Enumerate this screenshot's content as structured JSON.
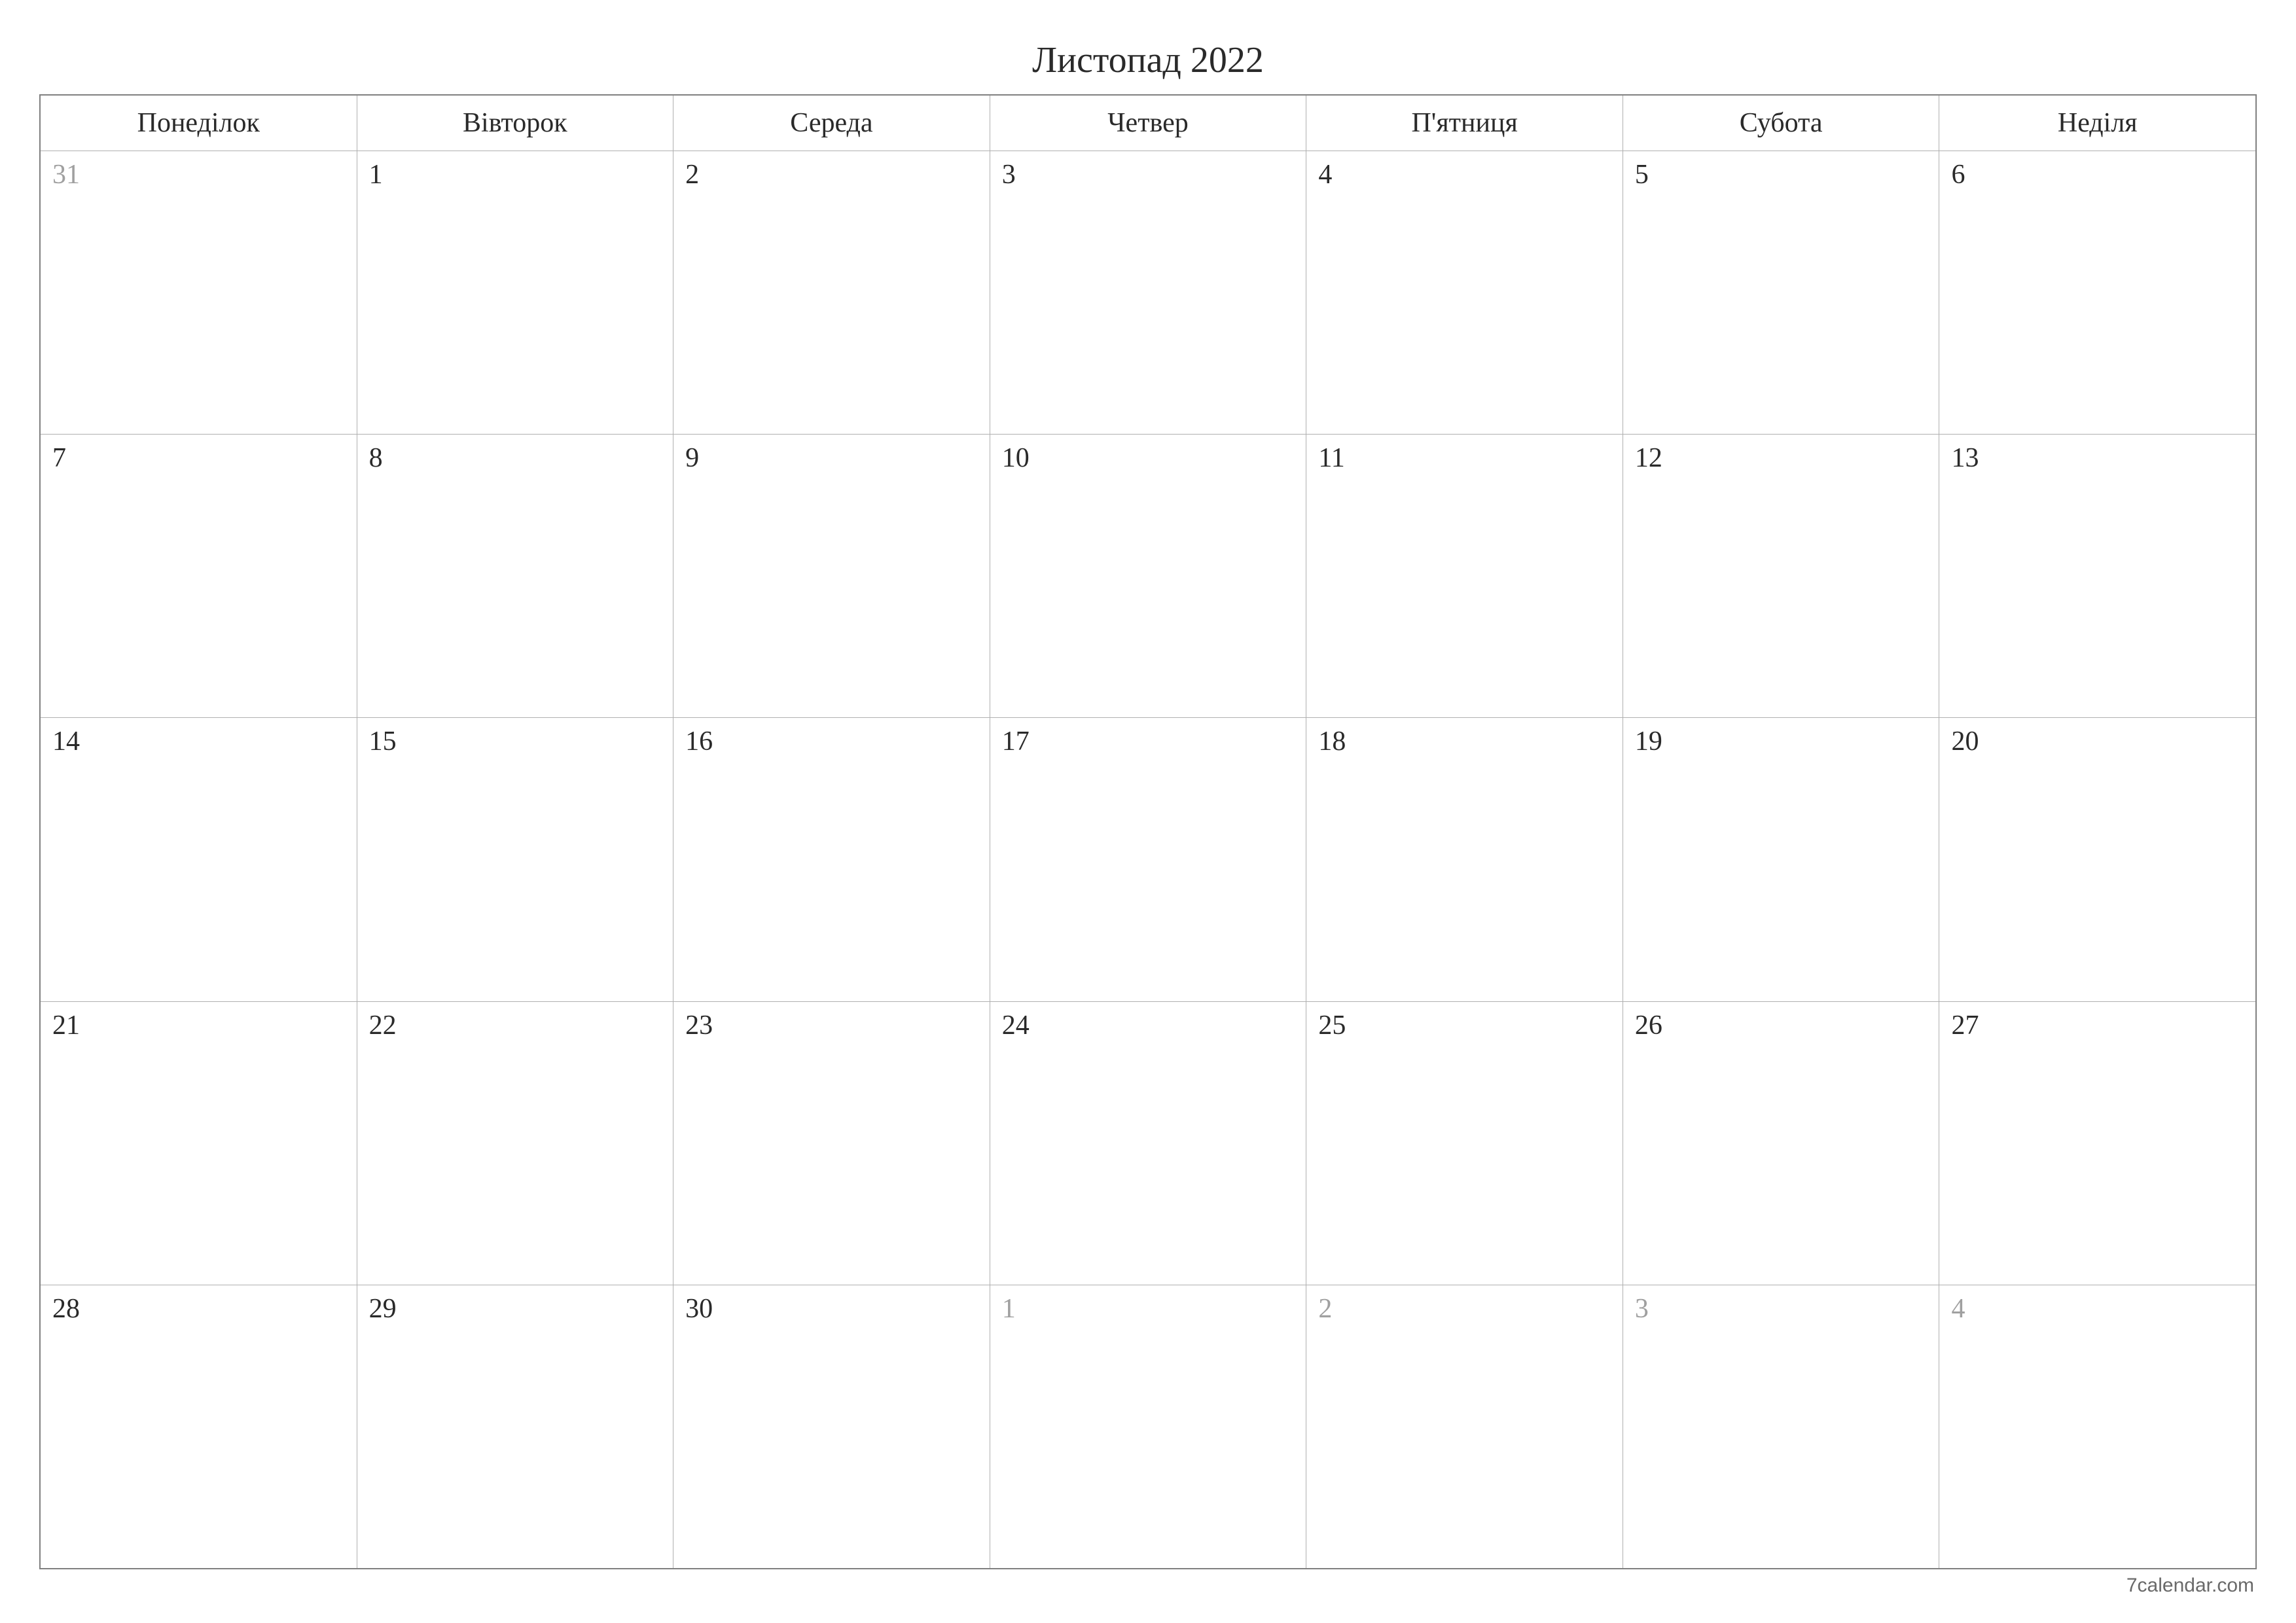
{
  "title": "Листопад 2022",
  "weekdays": [
    "Понеділок",
    "Вівторок",
    "Середа",
    "Четвер",
    "П'ятниця",
    "Субота",
    "Неділя"
  ],
  "weeks": [
    [
      {
        "day": "31",
        "other": true
      },
      {
        "day": "1",
        "other": false
      },
      {
        "day": "2",
        "other": false
      },
      {
        "day": "3",
        "other": false
      },
      {
        "day": "4",
        "other": false
      },
      {
        "day": "5",
        "other": false
      },
      {
        "day": "6",
        "other": false
      }
    ],
    [
      {
        "day": "7",
        "other": false
      },
      {
        "day": "8",
        "other": false
      },
      {
        "day": "9",
        "other": false
      },
      {
        "day": "10",
        "other": false
      },
      {
        "day": "11",
        "other": false
      },
      {
        "day": "12",
        "other": false
      },
      {
        "day": "13",
        "other": false
      }
    ],
    [
      {
        "day": "14",
        "other": false
      },
      {
        "day": "15",
        "other": false
      },
      {
        "day": "16",
        "other": false
      },
      {
        "day": "17",
        "other": false
      },
      {
        "day": "18",
        "other": false
      },
      {
        "day": "19",
        "other": false
      },
      {
        "day": "20",
        "other": false
      }
    ],
    [
      {
        "day": "21",
        "other": false
      },
      {
        "day": "22",
        "other": false
      },
      {
        "day": "23",
        "other": false
      },
      {
        "day": "24",
        "other": false
      },
      {
        "day": "25",
        "other": false
      },
      {
        "day": "26",
        "other": false
      },
      {
        "day": "27",
        "other": false
      }
    ],
    [
      {
        "day": "28",
        "other": false
      },
      {
        "day": "29",
        "other": false
      },
      {
        "day": "30",
        "other": false
      },
      {
        "day": "1",
        "other": true
      },
      {
        "day": "2",
        "other": true
      },
      {
        "day": "3",
        "other": true
      },
      {
        "day": "4",
        "other": true
      }
    ]
  ],
  "footer": "7calendar.com"
}
